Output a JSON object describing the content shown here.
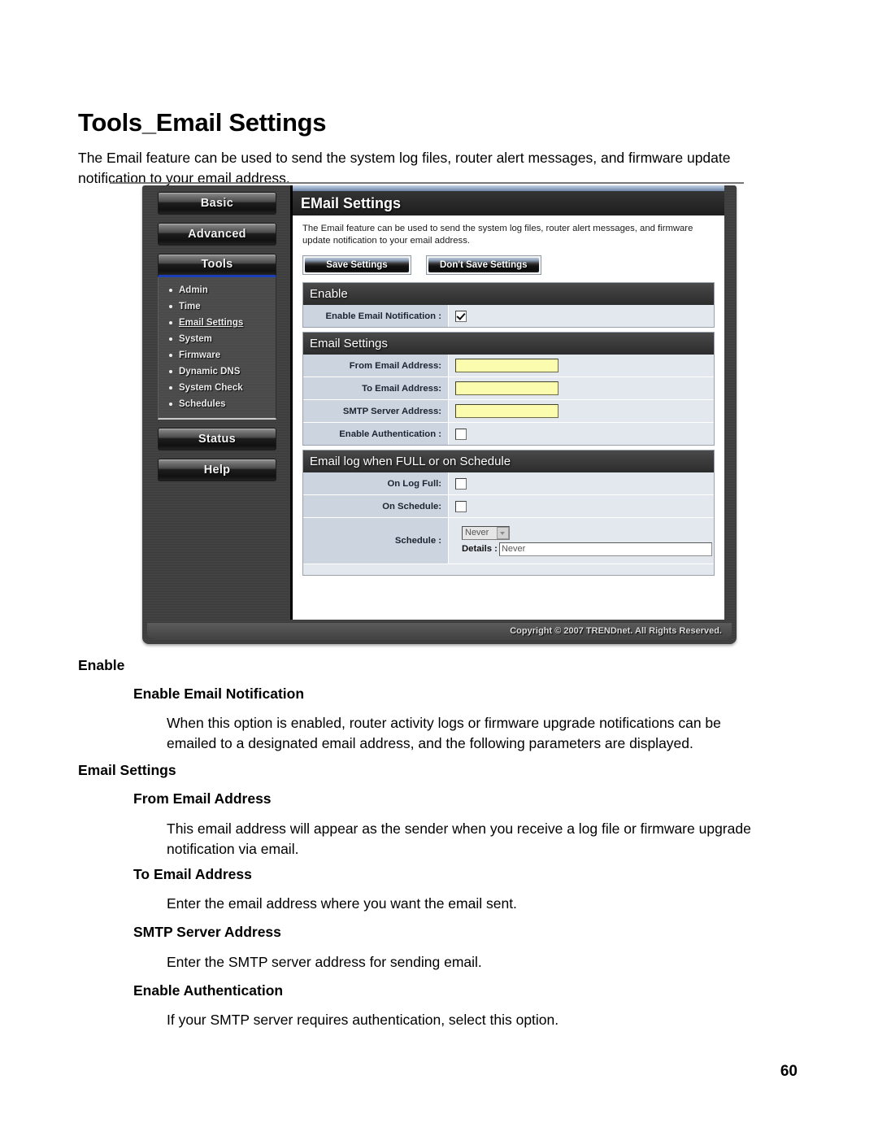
{
  "document": {
    "title": "Tools_Email Settings",
    "intro": "The Email feature can be used to send the system log files, router alert messages, and firmware update notification to your email address.",
    "page_number": "60",
    "sections": [
      {
        "heading": "Enable"
      },
      {
        "subheading": "Enable Email Notification"
      },
      {
        "body": "When this option is enabled, router activity logs or firmware upgrade notifications can be emailed to a designated email address, and the following parameters are displayed."
      },
      {
        "heading2": "Email Settings"
      },
      {
        "subheading2": "From Email Address"
      },
      {
        "body2": "This email address will appear as the sender when you receive a log file or firmware upgrade notification via email."
      },
      {
        "subheading3": "To Email Address"
      },
      {
        "body3": "Enter the email address where you want the email sent."
      },
      {
        "subheading4": "SMTP Server Address"
      },
      {
        "body4": "Enter the SMTP server address for sending email."
      },
      {
        "subheading5": "Enable Authentication"
      },
      {
        "body5": "If your SMTP server requires authentication, select this option."
      }
    ]
  },
  "router_ui": {
    "nav": {
      "buttons": [
        {
          "label": "Basic"
        },
        {
          "label": "Advanced"
        },
        {
          "label": "Tools"
        },
        {
          "label": "Status"
        },
        {
          "label": "Help"
        }
      ],
      "sub_items": [
        {
          "label": "Admin"
        },
        {
          "label": "Time"
        },
        {
          "label": "Email Settings"
        },
        {
          "label": "System"
        },
        {
          "label": "Firmware"
        },
        {
          "label": "Dynamic DNS"
        },
        {
          "label": "System Check"
        },
        {
          "label": "Schedules"
        }
      ]
    },
    "panel": {
      "title": "EMail Settings",
      "description": "The Email feature can be used to send the system log files, router alert messages, and firmware update notification to your email address.",
      "save_button": "Save Settings",
      "dont_save_button": "Don't Save Settings"
    },
    "enable_section": {
      "header": "Enable",
      "rows": [
        {
          "label": "Enable Email Notification :",
          "type": "checkbox",
          "checked": true
        }
      ]
    },
    "email_settings_section": {
      "header": "Email Settings",
      "rows": [
        {
          "label": "From Email Address:",
          "type": "text",
          "value": ""
        },
        {
          "label": "To Email Address:",
          "type": "text",
          "value": ""
        },
        {
          "label": "SMTP Server Address:",
          "type": "text",
          "value": ""
        },
        {
          "label": "Enable Authentication :",
          "type": "checkbox",
          "checked": false
        }
      ]
    },
    "schedule_section": {
      "header": "Email log when FULL or on Schedule",
      "on_log_full_label": "On Log Full:",
      "on_schedule_label": "On Schedule:",
      "schedule_label": "Schedule :",
      "schedule_select_value": "Never",
      "details_label": "Details :",
      "details_value": "Never"
    },
    "footer": "Copyright © 2007 TRENDnet. All Rights Reserved."
  },
  "colors": {
    "accent_blue": "#1b3fb5",
    "field_yellow": "#fcfcae",
    "label_bg": "#ccd4df",
    "row_bg": "#e3e8ee",
    "bezel": "#3e3e3e"
  }
}
